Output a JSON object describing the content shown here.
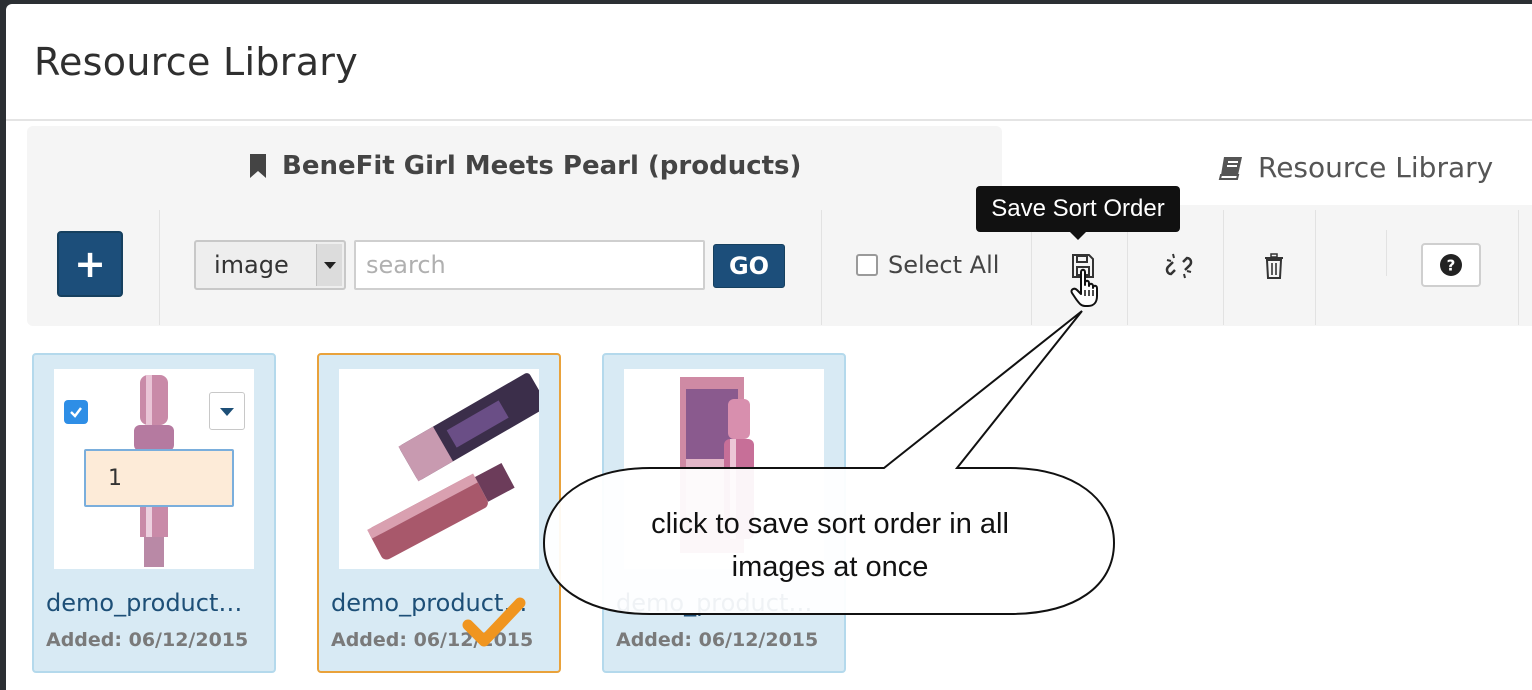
{
  "modal": {
    "title": "Resource Library"
  },
  "collection": {
    "title": "BeneFit Girl Meets Pearl (products)"
  },
  "library_link": {
    "label": "Resource Library"
  },
  "toolbar": {
    "add_label": "+",
    "type_select": {
      "value": "image"
    },
    "search": {
      "placeholder": "search",
      "value": ""
    },
    "go_label": "GO",
    "select_all_label": "Select All",
    "tooltip": "Save Sort Order"
  },
  "cards": [
    {
      "name": "demo_product…",
      "date": "Added: 06/12/2015",
      "checked": true,
      "sort_value": "1"
    },
    {
      "name": "demo_product…",
      "date": "Added: 06/12/2015",
      "selected": true
    },
    {
      "name": "demo_product…",
      "date": "Added: 06/12/2015"
    }
  ],
  "callout": {
    "line1": "click to save sort order in all",
    "line2": "images at once"
  },
  "colors": {
    "primary": "#1c4e7a",
    "card_bg": "#d8eaf4",
    "card_selected_border": "#e9a23b",
    "checkbox": "#2e8ee6",
    "sort_input_bg": "#fdebd8"
  },
  "icons": [
    "bookmark-icon",
    "book-icon",
    "plus-icon",
    "floppy-save-icon",
    "unlink-icon",
    "trash-icon",
    "question-circle-icon",
    "hand-pointer-icon",
    "checkmark-icon"
  ]
}
